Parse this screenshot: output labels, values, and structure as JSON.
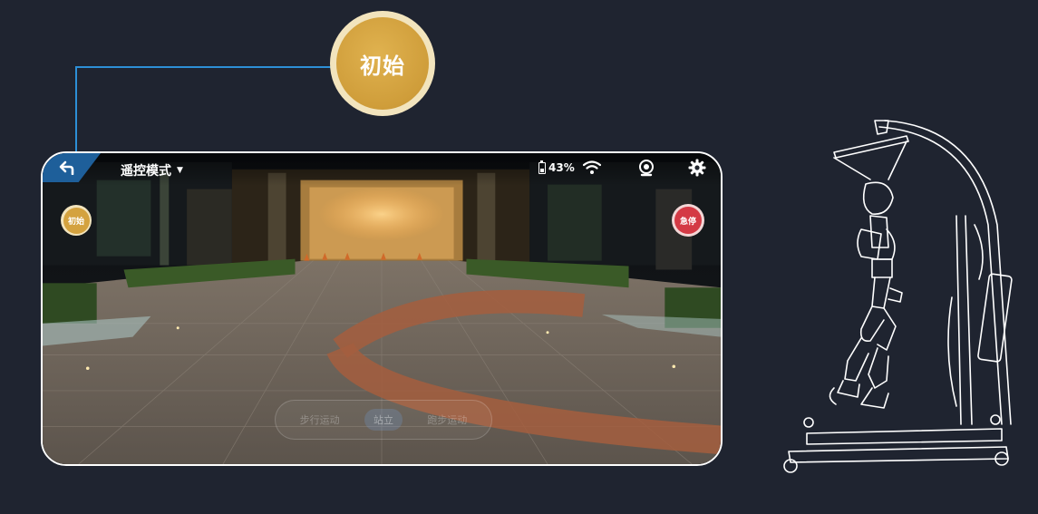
{
  "callout": {
    "label": "初始"
  },
  "app": {
    "mode_label": "遥控模式",
    "battery": "43%",
    "battery_level": 0.43,
    "buttons": {
      "init": "初始",
      "estop": "急停"
    },
    "gait_modes": [
      {
        "label": "步行运动",
        "active": false
      },
      {
        "label": "站立",
        "active": true
      },
      {
        "label": "跑步运动",
        "active": false
      }
    ]
  },
  "colors": {
    "background": "#1f2430",
    "connector": "#2d8fd6",
    "init_gold": "#d4a23f",
    "estop_red": "#d43a45",
    "back_tab": "#1e5f9a"
  },
  "icons": [
    "back-arrow-icon",
    "dropdown-caret-icon",
    "battery-icon",
    "wifi-icon",
    "camera-icon",
    "gear-icon"
  ]
}
